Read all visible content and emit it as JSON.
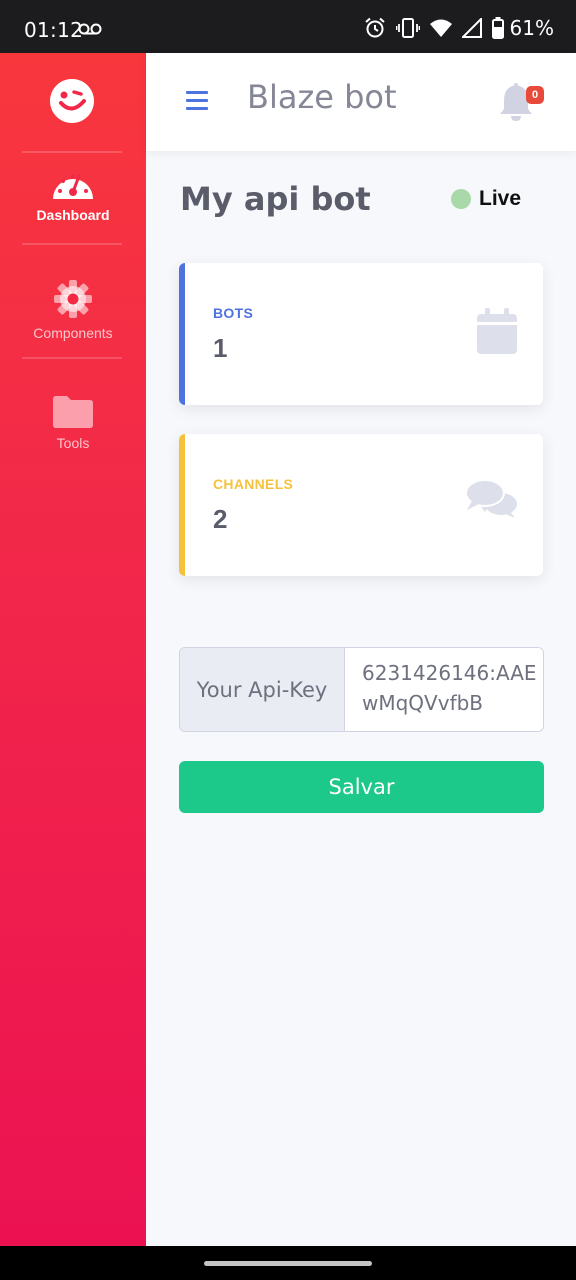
{
  "status_bar": {
    "time": "01:12",
    "battery": "61%"
  },
  "sidebar": {
    "items": [
      {
        "label": "Dashboard",
        "icon": "tachometer-icon",
        "active": true
      },
      {
        "label": "Components",
        "icon": "cog-icon",
        "active": false
      },
      {
        "label": "Tools",
        "icon": "folder-icon",
        "active": false
      }
    ]
  },
  "topbar": {
    "title": "Blaze bot",
    "notification_count": "0"
  },
  "main": {
    "title": "My api bot",
    "status": "Live",
    "cards": [
      {
        "label": "BOTS",
        "value": "1",
        "icon": "calendar-icon",
        "color": "#4e73df"
      },
      {
        "label": "CHANNELS",
        "value": "2",
        "icon": "comments-icon",
        "color": "#f6c23e"
      }
    ],
    "api_key": {
      "prefix": "Your Api-Key",
      "value": "6231426146:AAEwMqQVvfbB"
    },
    "save_label": "Salvar"
  },
  "colors": {
    "primary": "#4e73df",
    "success": "#1cc88a",
    "warning": "#f6c23e",
    "danger": "#e74a3b",
    "sidebar": "#f22849"
  }
}
